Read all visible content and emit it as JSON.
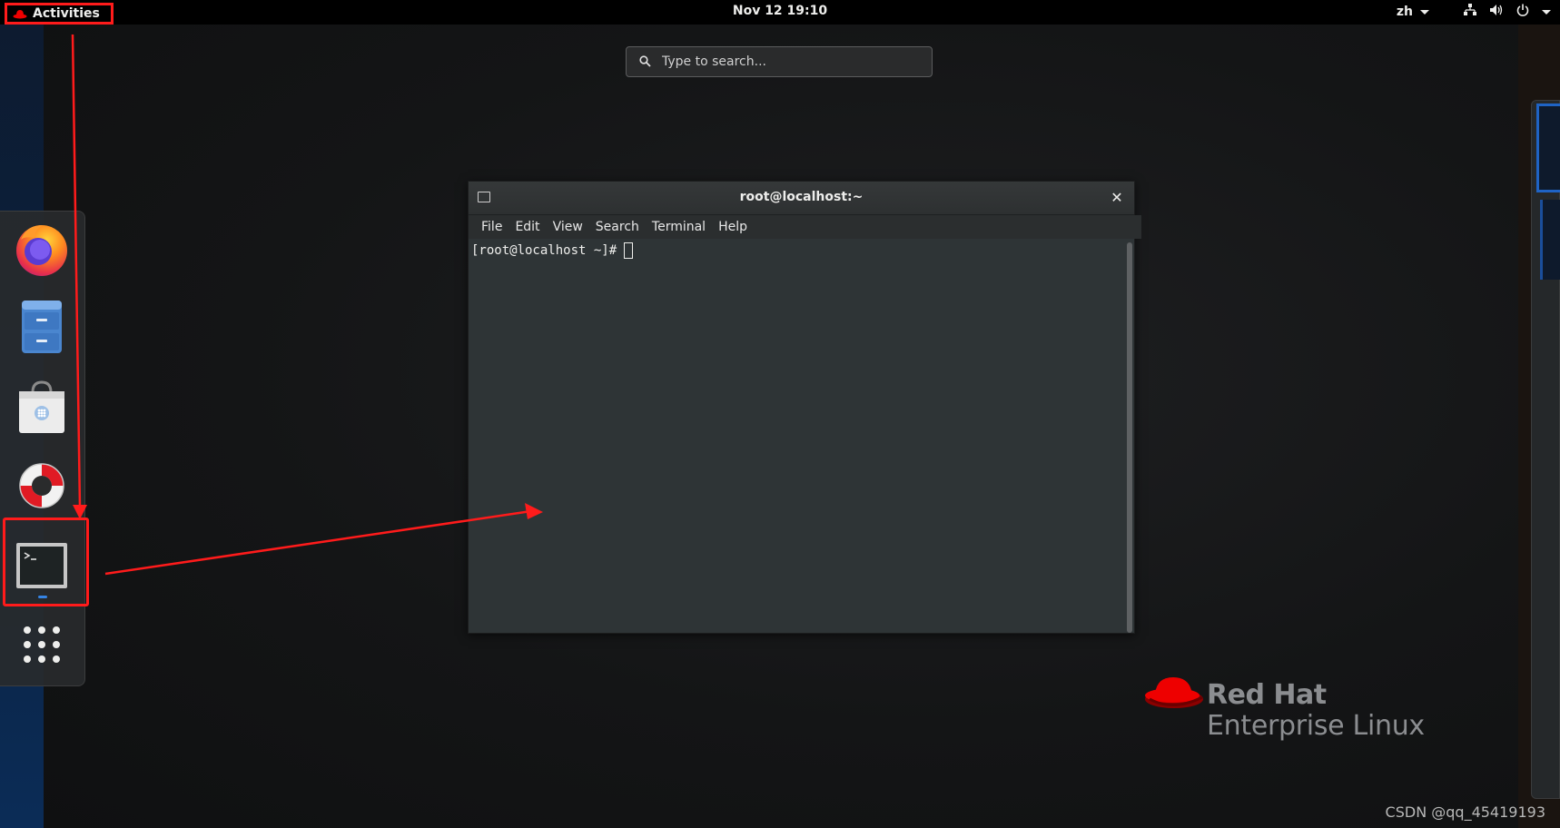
{
  "topbar": {
    "activities_label": "Activities",
    "clock": "Nov 12  19:10",
    "language": "zh"
  },
  "search": {
    "placeholder": "Type to search..."
  },
  "dash": {
    "items": [
      {
        "name": "firefox",
        "icon": "firefox-icon"
      },
      {
        "name": "files",
        "icon": "file-cabinet-icon"
      },
      {
        "name": "software",
        "icon": "shopping-bag-icon"
      },
      {
        "name": "help",
        "icon": "lifebuoy-icon"
      },
      {
        "name": "terminal",
        "icon": "terminal-icon",
        "running": true
      },
      {
        "name": "show-applications",
        "icon": "app-grid-icon"
      }
    ]
  },
  "terminal": {
    "title": "root@localhost:~",
    "menu": [
      "File",
      "Edit",
      "View",
      "Search",
      "Terminal",
      "Help"
    ],
    "prompt": "[root@localhost ~]#"
  },
  "branding": {
    "line1": "Red Hat",
    "line2": "Enterprise Linux"
  },
  "watermark": "CSDN @qq_45419193",
  "colors": {
    "annotation_red": "#ff1b1b",
    "redhat_red": "#ee0000",
    "accent_blue": "#3584e4",
    "terminal_bg": "#2e3436"
  }
}
